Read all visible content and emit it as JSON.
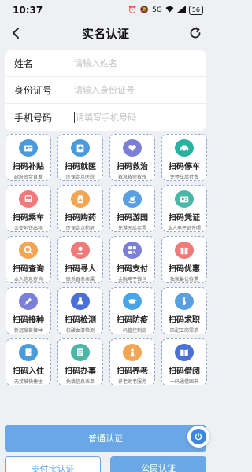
{
  "status_bar": {
    "time": "10:37",
    "network": "5G",
    "battery": "56"
  },
  "nav": {
    "title": "实名认证"
  },
  "form": {
    "fields": [
      {
        "label": "姓名",
        "placeholder": "请输入姓名"
      },
      {
        "label": "身份证号",
        "placeholder": "请输入身份证号"
      },
      {
        "label": "手机号码",
        "placeholder": "请填写手机号码"
      }
    ]
  },
  "tiles": [
    {
      "title": "扫码补贴",
      "subtitle": "政府资金直发",
      "icon": "id-card-icon",
      "color": "#4a9bdc"
    },
    {
      "title": "扫码就医",
      "subtitle": "医保定点医院",
      "icon": "hospital-icon",
      "color": "#4a9bdc"
    },
    {
      "title": "扫码救治",
      "subtitle": "救急救命救残",
      "icon": "heart-hand-icon",
      "color": "#7b7fd6"
    },
    {
      "title": "扫码停车",
      "subtitle": "免停车后付费",
      "icon": "car-icon",
      "color": "#27b3a0"
    },
    {
      "title": "扫码乘车",
      "subtitle": "公交地铁出租",
      "icon": "bus-icon",
      "color": "#f07a7a"
    },
    {
      "title": "扫码购药",
      "subtitle": "医保定点药房",
      "icon": "medicine-icon",
      "color": "#f2a553"
    },
    {
      "title": "扫码游园",
      "subtitle": "先游园后买票",
      "icon": "rocking-horse-icon",
      "color": "#5aa0e0"
    },
    {
      "title": "扫码凭证",
      "subtitle": "本人电子证件照",
      "icon": "id-badge-icon",
      "color": "#4ab7a8"
    },
    {
      "title": "扫码查询",
      "subtitle": "本人信息查询",
      "icon": "search-icon",
      "color": "#f2a553"
    },
    {
      "title": "扫码寻人",
      "subtitle": "联系直系亲属",
      "icon": "person-location-icon",
      "color": "#f07a7a"
    },
    {
      "title": "扫码支付",
      "subtitle": "金融电子钱包",
      "icon": "qr-pay-icon",
      "color": "#7b7fd6"
    },
    {
      "title": "扫码优惠",
      "subtitle": "独家最优待遇",
      "icon": "gift-icon",
      "color": "#f07a7a"
    },
    {
      "title": "扫码接种",
      "subtitle": "新冠疫苗接种",
      "icon": "syringe-icon",
      "color": "#7b7fd6"
    },
    {
      "title": "扫码检测",
      "subtitle": "核酸血清检测",
      "icon": "flask-icon",
      "color": "#4a6fd6"
    },
    {
      "title": "扫码防疫",
      "subtitle": "一码管控到底",
      "icon": "mask-icon",
      "color": "#4aa4e8"
    },
    {
      "title": "扫码求职",
      "subtitle": "匹配工岗需求",
      "icon": "tie-icon",
      "color": "#5a9fe0"
    },
    {
      "title": "扫码入住",
      "subtitle": "无接触快捷住",
      "icon": "door-icon",
      "color": "#4a9bdc"
    },
    {
      "title": "扫码办事",
      "subtitle": "免填信息表单",
      "icon": "form-icon",
      "color": "#4ab7a8"
    },
    {
      "title": "扫码养老",
      "subtitle": "养老助老服务",
      "icon": "elder-icon",
      "color": "#f2a553"
    },
    {
      "title": "扫码借阅",
      "subtitle": "一码通借图书",
      "icon": "book-icon",
      "color": "#4a6fd6"
    }
  ],
  "buttons": {
    "primary": "普通认证",
    "secondary_left": "支付宝认证",
    "secondary_right": "公民认证"
  },
  "colors": {
    "accent": "#6aa7e6",
    "background": "#eef0f4",
    "tile_border": "#8fa6d6"
  }
}
